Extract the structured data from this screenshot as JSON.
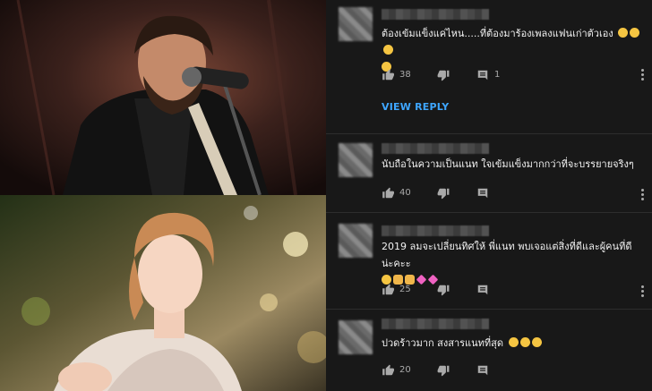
{
  "comments": [
    {
      "text": "ต้องเข้มแข็งแค่ไหน.....ที่ต้องมาร้องเพลงแฟนเก่าตัวเอง",
      "likes": "38",
      "replies": "1",
      "view_reply": "VIEW REPLY"
    },
    {
      "text": "นับถือในความเป็นแนท ใจเข้มแข็งมากกว่าที่จะบรรยายจริงๆ",
      "likes": "40"
    },
    {
      "text_line1": "2019 ลมจะเปลี่ยนทิศให้ พี่แนท พบเจอแต่สิ่งที่ดีและผู้คนที่ดีน่ะคะะ",
      "likes": "25"
    },
    {
      "text": "ปวดร้าวมาก สงสารแนทที่สุด",
      "likes": "20"
    }
  ],
  "icons": {
    "like": "thumb-up-icon",
    "dislike": "thumb-down-icon",
    "reply": "comment-icon",
    "more": "more-vert-icon"
  },
  "colors": {
    "panel_bg": "#181818",
    "link": "#3ea6ff",
    "text": "#f1f1f1",
    "muted": "#aaaaaa"
  }
}
